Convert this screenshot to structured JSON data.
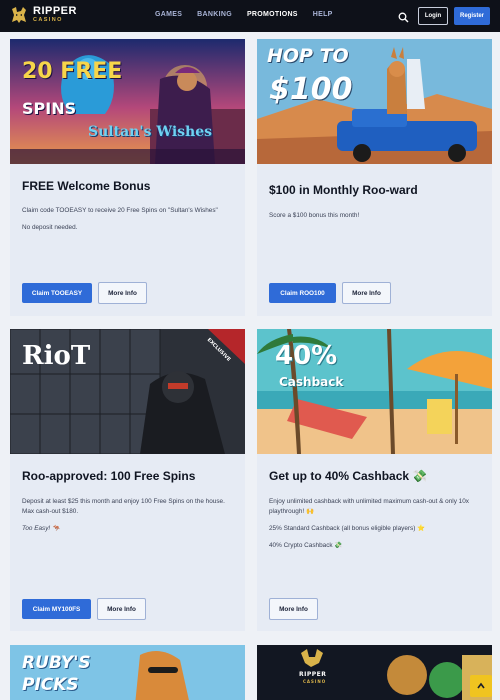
{
  "header": {
    "logo_name": "RIPPER",
    "logo_sub": "CASINO",
    "nav": [
      "GAMES",
      "BANKING",
      "PROMOTIONS",
      "HELP"
    ],
    "active_nav": "PROMOTIONS",
    "login_label": "Login",
    "register_label": "Register"
  },
  "promos": [
    {
      "title": "FREE Welcome Bonus",
      "art_text_a": "20 FREE",
      "art_text_b": "SPINS",
      "art_text_c": "Sultan's Wishes",
      "desc": [
        "Claim code TOOEASY to receive 20 Free Spins on \"Sultan's Wishes\"",
        "No deposit needed."
      ],
      "claim_label": "Claim TOOEASY",
      "more_label": "More Info"
    },
    {
      "title": "$100 in Monthly Roo-ward",
      "art_text_a": "HOP TO",
      "art_text_b": "$100",
      "desc": [
        "Score a $100 bonus this month!"
      ],
      "claim_label": "Claim ROO100",
      "more_label": "More Info"
    },
    {
      "title": "Roo-approved: 100 Free Spins",
      "art_text_a": "RioT",
      "art_text_b": "EXCLUSIVE",
      "desc": [
        "Deposit at least $25 this month and enjoy 100 Free Spins on the house. Max cash-out $180."
      ],
      "note": "Too Easy! 🦘",
      "claim_label": "Claim MY100FS",
      "more_label": "More Info"
    },
    {
      "title": "Get up to 40% Cashback 💸",
      "art_text_a": "40%",
      "art_text_b": "Cashback",
      "desc": [
        "Enjoy unlimited cashback with unlimited maximum cash-out & only 10x playthrough! 🙌",
        "25% Standard Cashback (all bonus eligible players) ⭐",
        "40% Crypto Cashback 💸"
      ],
      "more_label": "More Info"
    },
    {
      "art_text_a": "RUBY'S",
      "art_text_b": "PICKS"
    },
    {
      "art_text_a": "RIPPER",
      "art_text_b": "CASINO"
    }
  ],
  "colors": {
    "header_bg": "#0e1119",
    "primary_button": "#2f6bd8",
    "card_bg": "#e6ebf4",
    "page_bg": "#eef1f6",
    "scroll_top": "#f0c420"
  }
}
